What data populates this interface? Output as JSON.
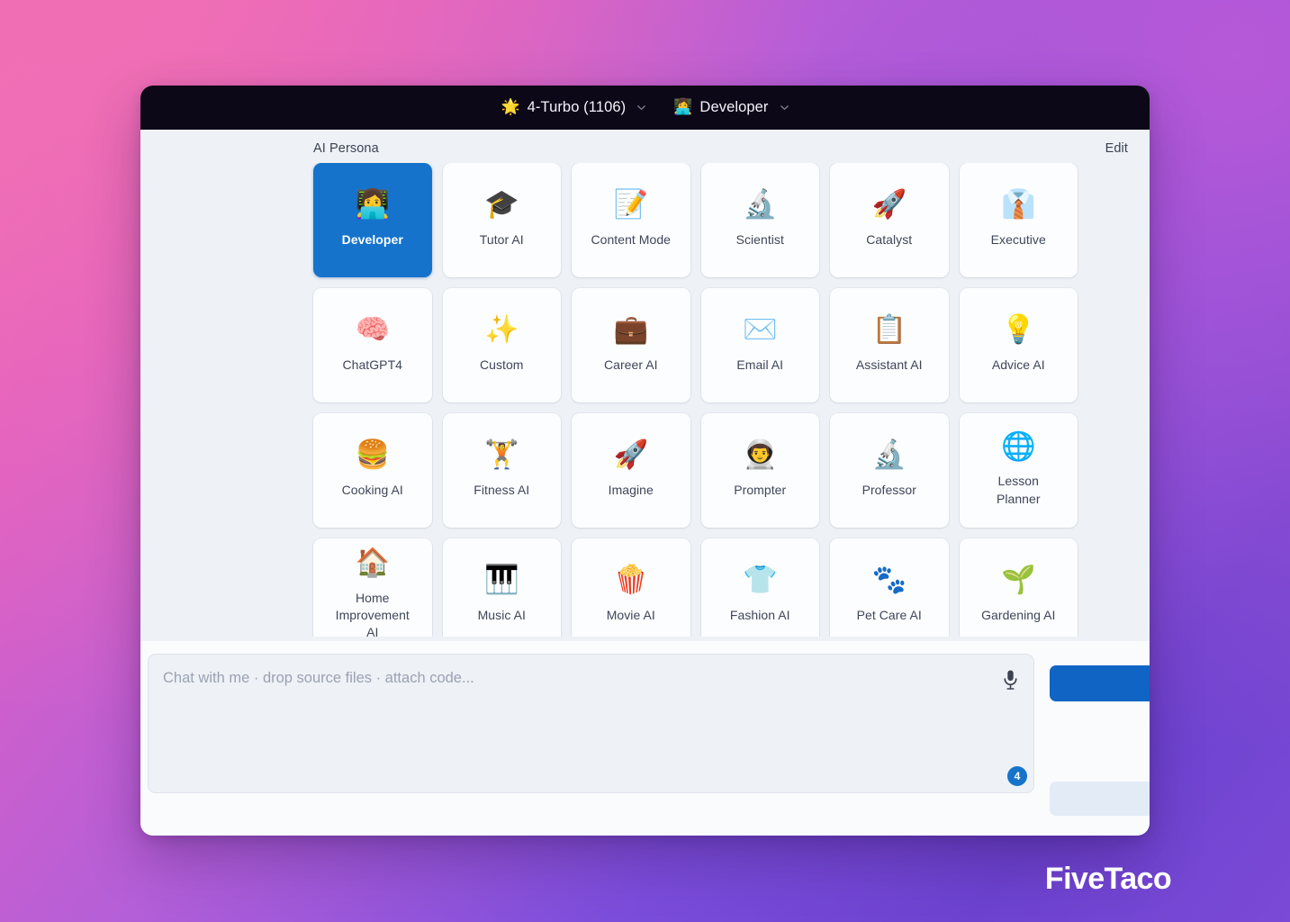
{
  "titlebar": {
    "model": {
      "icon": "sun-icon",
      "glyph": "🌟",
      "label": "4-Turbo (1106)"
    },
    "persona": {
      "icon": "person-at-laptop-icon",
      "glyph": "👩‍💻",
      "label": "Developer"
    }
  },
  "persona_panel": {
    "title": "AI Persona",
    "edit_label": "Edit",
    "selected": "Developer",
    "accent_color": "#1573CC",
    "cards": [
      {
        "label": "Developer",
        "icon": "person-at-laptop-icon",
        "glyph": "👩‍💻",
        "selected": true
      },
      {
        "label": "Tutor AI",
        "icon": "graduation-cap-icon",
        "glyph": "🎓",
        "selected": false
      },
      {
        "label": "Content Mode",
        "icon": "memo-pencil-icon",
        "glyph": "📝",
        "selected": false
      },
      {
        "label": "Scientist",
        "icon": "microscope-icon",
        "glyph": "🔬",
        "selected": false
      },
      {
        "label": "Catalyst",
        "icon": "rocket-icon",
        "glyph": "🚀",
        "selected": false
      },
      {
        "label": "Executive",
        "icon": "necktie-suit-icon",
        "glyph": "👔",
        "selected": false
      },
      {
        "label": "ChatGPT4",
        "icon": "brain-icon",
        "glyph": "🧠",
        "selected": false
      },
      {
        "label": "Custom",
        "icon": "sparkles-icon",
        "glyph": "✨",
        "selected": false
      },
      {
        "label": "Career AI",
        "icon": "briefcase-icon",
        "glyph": "💼",
        "selected": false
      },
      {
        "label": "Email AI",
        "icon": "envelope-icon",
        "glyph": "✉️",
        "selected": false
      },
      {
        "label": "Assistant AI",
        "icon": "clipboard-icon",
        "glyph": "📋",
        "selected": false
      },
      {
        "label": "Advice AI",
        "icon": "lightbulb-icon",
        "glyph": "💡",
        "selected": false
      },
      {
        "label": "Cooking AI",
        "icon": "hamburger-icon",
        "glyph": "🍔",
        "selected": false
      },
      {
        "label": "Fitness AI",
        "icon": "weightlifter-icon",
        "glyph": "🏋️",
        "selected": false
      },
      {
        "label": "Imagine",
        "icon": "rocket-icon",
        "glyph": "🚀",
        "selected": false
      },
      {
        "label": "Prompter",
        "icon": "astronaut-icon",
        "glyph": "👨‍🚀",
        "selected": false
      },
      {
        "label": "Professor",
        "icon": "microscope-icon",
        "glyph": "🔬",
        "selected": false
      },
      {
        "label": "Lesson\nPlanner",
        "icon": "globe-icon",
        "glyph": "🌐",
        "selected": false
      },
      {
        "label": "Home\nImprovement\nAI",
        "icon": "house-icon",
        "glyph": "🏠",
        "selected": false
      },
      {
        "label": "Music AI",
        "icon": "piano-keyboard-icon",
        "glyph": "🎹",
        "selected": false
      },
      {
        "label": "Movie AI",
        "icon": "popcorn-icon",
        "glyph": "🍿",
        "selected": false
      },
      {
        "label": "Fashion AI",
        "icon": "tshirt-icon",
        "glyph": "👕",
        "selected": false
      },
      {
        "label": "Pet Care AI",
        "icon": "paw-prints-icon",
        "glyph": "🐾",
        "selected": false
      },
      {
        "label": "Gardening AI",
        "icon": "seedling-icon",
        "glyph": "🌱",
        "selected": false
      }
    ]
  },
  "composer": {
    "value": "",
    "placeholder": "Chat with me · drop source files · attach code...",
    "mic_icon": "microphone-icon",
    "attachment_count": "4",
    "primary_button_label": "",
    "secondary_button_label": ""
  },
  "watermark": {
    "text": "FiveTaco"
  }
}
